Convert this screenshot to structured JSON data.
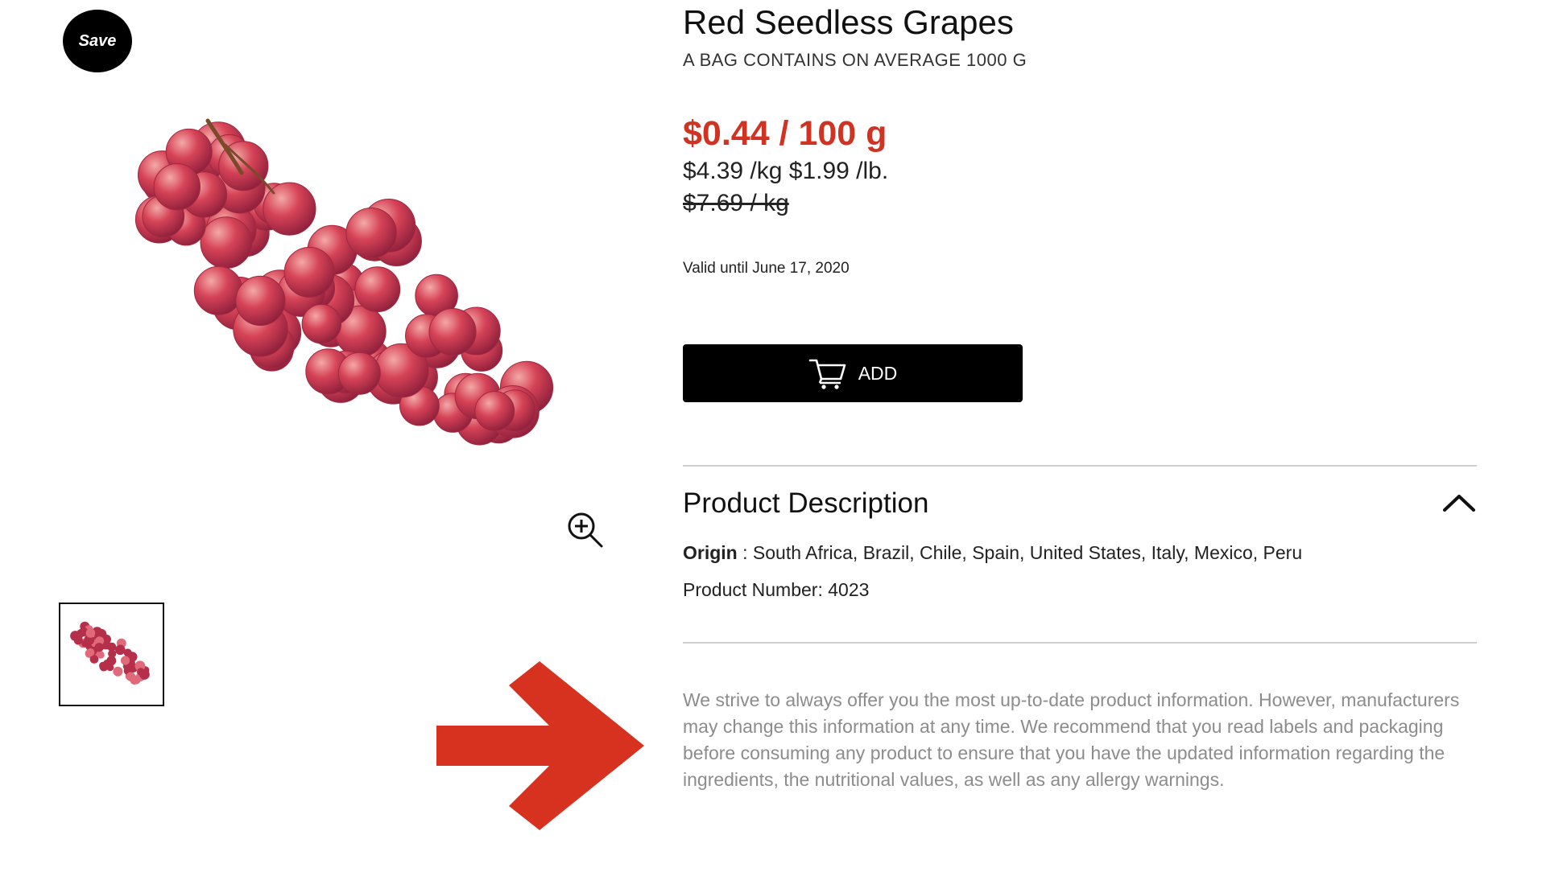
{
  "save_badge": {
    "label": "Save"
  },
  "product": {
    "title": "Red Seedless Grapes",
    "subtitle": "A BAG CONTAINS ON AVERAGE 1000 G",
    "price_main": "$0.44 / 100 g",
    "price_units": "$4.39 /kg $1.99 /lb.",
    "price_old": "$7.69 / kg",
    "valid_until": "Valid until June 17, 2020",
    "add_button_label": "ADD"
  },
  "description": {
    "heading": "Product Description",
    "origin_label": "Origin",
    "origin_value": " : South Africa, Brazil, Chile, Spain, United States, Italy, Mexico, Peru",
    "product_number": "Product Number: 4023",
    "disclaimer": "We strive to always offer you the most up-to-date product information. However, manufacturers may change this information at any time. We recommend that you read labels and packaging before consuming any product to ensure that you have the updated information regarding the ingredients, the nutritional values, as well as any allergy warnings."
  },
  "icons": {
    "zoom": "zoom-in-icon",
    "cart": "shopping-cart-icon",
    "chevron": "chevron-up-icon",
    "arrow": "annotation-arrow-right"
  },
  "colors": {
    "price_accent": "#d03322",
    "arrow": "#d6321f",
    "button_bg": "#000000",
    "grape": "#c9334a"
  }
}
